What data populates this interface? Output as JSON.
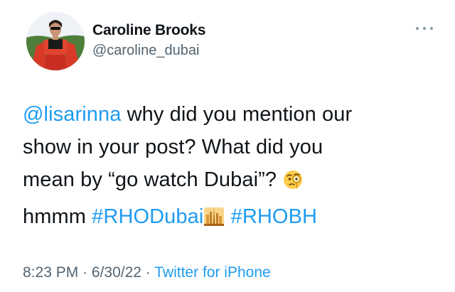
{
  "author": {
    "display_name": "Caroline Brooks",
    "handle": "@caroline_dubai"
  },
  "tweet": {
    "mention": "@lisarinna",
    "text_line1": " why did you mention our",
    "text_line2": "show in your post? What did you",
    "text_line3": "mean by “go watch Dubai”? ",
    "text_line4": "hmmm ",
    "hashtag1": "#RHODubai",
    "hashtag2": "#RHOBH",
    "emoji1": "face-with-monocle-emoji",
    "emoji2": "cityscape-emoji"
  },
  "meta": {
    "time": "8:23 PM",
    "separator1": " · ",
    "date": "6/30/22",
    "separator2": " · ",
    "source": "Twitter for iPhone"
  },
  "colors": {
    "link": "#1d9bf0",
    "secondary_text": "#536471",
    "primary_text": "#0f1419"
  }
}
